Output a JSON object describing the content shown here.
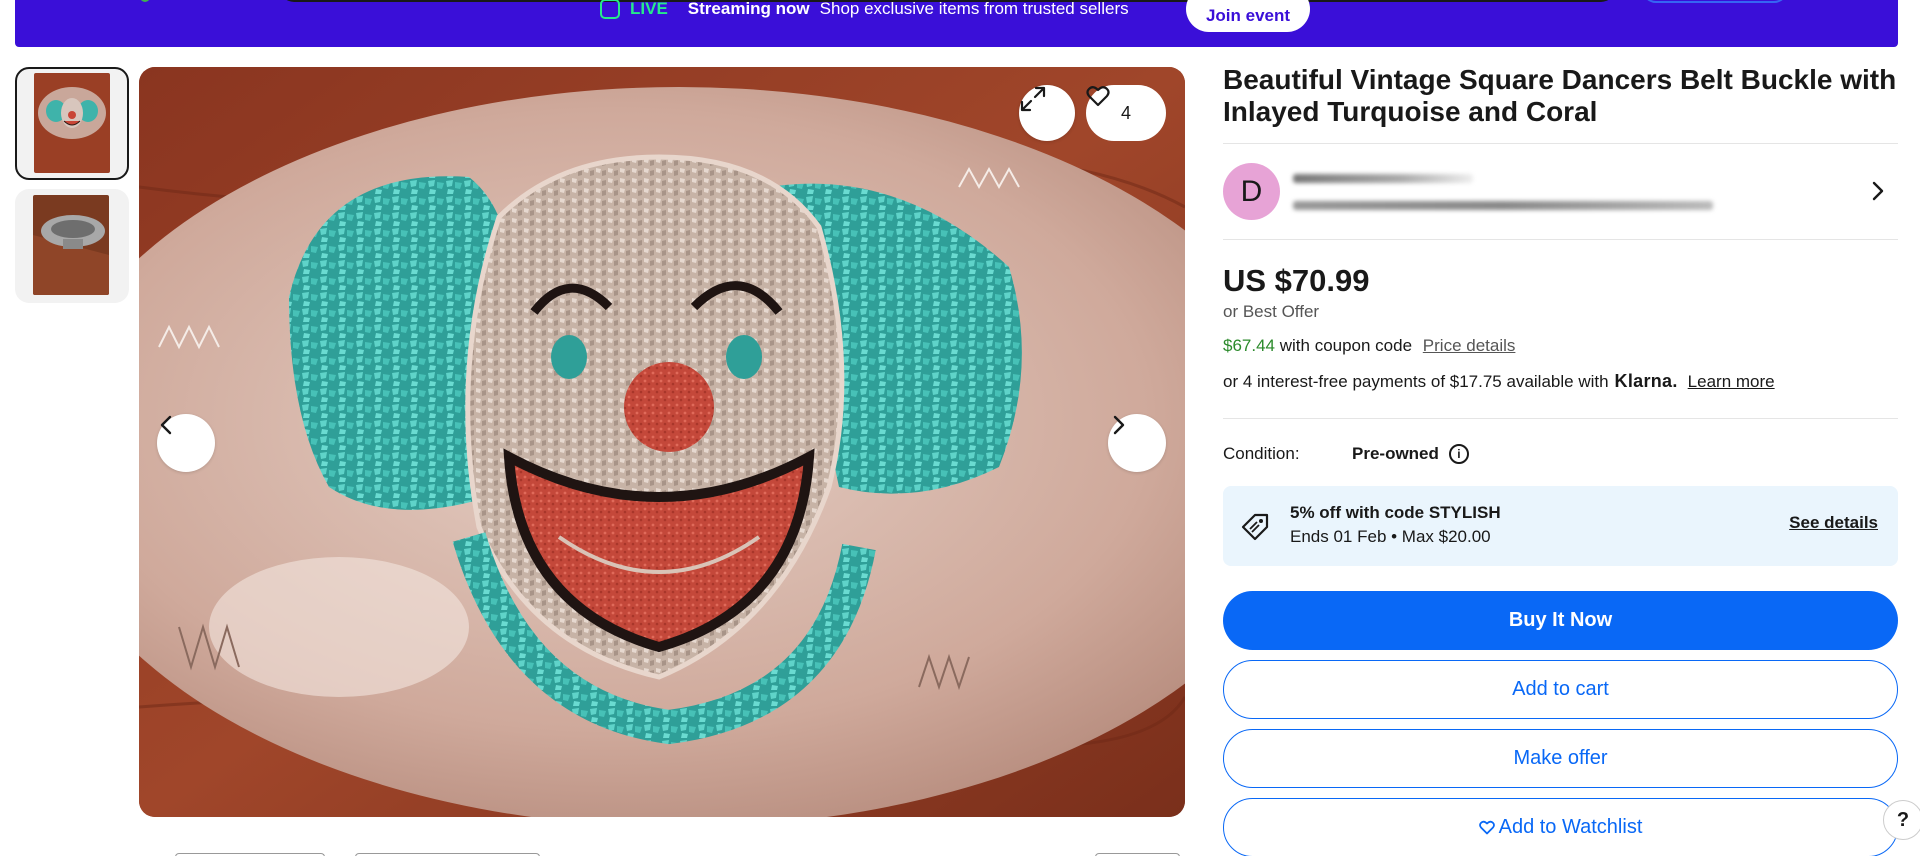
{
  "banner": {
    "live_label": "LIVE",
    "streaming_label": "Streaming now",
    "shop_text": "Shop exclusive items from trusted sellers",
    "join_label": "Join event"
  },
  "gallery": {
    "watch_count": "4",
    "thumbnails": [
      "thumbnail-1",
      "thumbnail-2"
    ]
  },
  "listing": {
    "title": "Beautiful Vintage Square Dancers Belt Buckle with Inlayed Turquoise and Coral",
    "seller_initial": "D",
    "price": "US $70.99",
    "best_offer": "or Best Offer",
    "coupon_price": "$67.44",
    "coupon_text": "with coupon code",
    "price_details_label": "Price details",
    "klarna_prefix": "or 4 interest-free payments of $17.75 available with",
    "klarna_logo": "Klarna.",
    "learn_more_label": "Learn more",
    "condition_label": "Condition:",
    "condition_value": "Pre-owned"
  },
  "promo": {
    "title": "5% off with code STYLISH",
    "subtitle": "Ends 01 Feb • Max $20.00",
    "link_label": "See details"
  },
  "actions": {
    "buy_now": "Buy It Now",
    "add_to_cart": "Add to cart",
    "make_offer": "Make offer",
    "watchlist": "Add to Watchlist"
  },
  "help_label": "?",
  "colors": {
    "banner_bg": "#3a0fd8",
    "live_green": "#27e88a",
    "primary_blue": "#0968f6",
    "coupon_green": "#2b8a2b",
    "promo_bg": "#eaf5fd",
    "avatar_pink": "#e7a3d6"
  },
  "icons": [
    "expand-icon",
    "heart-icon",
    "chevron-left-icon",
    "chevron-right-icon",
    "tag-icon",
    "info-icon",
    "live-icon"
  ]
}
